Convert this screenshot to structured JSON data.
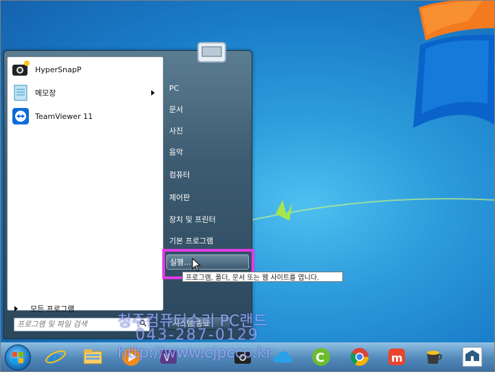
{
  "start_menu": {
    "pinned_programs": [
      {
        "label": "HyperSnapP",
        "icon": "camera-icon"
      },
      {
        "label": "메모장",
        "icon": "notepad-icon"
      },
      {
        "label": "TeamViewer 11",
        "icon": "teamviewer-icon"
      }
    ],
    "all_programs_label": "모든 프로그램",
    "search_placeholder": "프로그램 및 파일 검색",
    "right_items": [
      "PC",
      "문서",
      "사진",
      "음악",
      "컴퓨터",
      "제어판",
      "장치 및 프린터",
      "기본 프로그램",
      "실행..."
    ],
    "shutdown_label": "시스템 종료"
  },
  "tooltip": "프로그램, 폴더, 문서 또는 웹 사이트를 엽니다.",
  "watermark": {
    "line1": "청주컴퓨터수리 PC랜드",
    "line2": "043-287-0129",
    "line3": "http://www.cjpcco.kr"
  },
  "taskbar": {
    "icons": [
      "start-orb-icon",
      "internet-explorer-icon",
      "file-explorer-icon",
      "media-player-icon",
      "app-icon",
      "camera-icon",
      "cloud-icon",
      "ccleaner-icon",
      "chrome-icon",
      "app-m-icon",
      "cup-icon",
      "building-icon"
    ]
  },
  "colors": {
    "highlight": "#e43ae6",
    "desktop": "#1a7cc8"
  }
}
